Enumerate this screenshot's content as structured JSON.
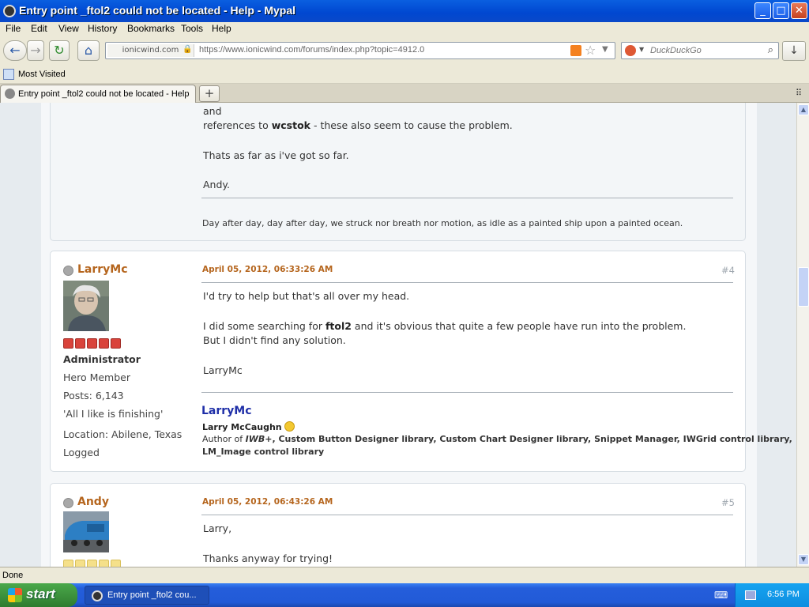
{
  "window": {
    "title": "Entry point _ftol2 could not be located - Help - Mypal",
    "min": "_",
    "max": "□",
    "close": "✕"
  },
  "menu": [
    "File",
    "Edit",
    "View",
    "History",
    "Bookmarks",
    "Tools",
    "Help"
  ],
  "nav": {
    "back": "←",
    "forward": "→",
    "reload": "↻",
    "home": "⌂",
    "site": "ionicwind.com",
    "url": "https://www.ionicwind.com/forums/index.php?topic=4912.0",
    "search_placeholder": "DuckDuckGo",
    "download": "↓"
  },
  "bookmarks": {
    "most_visited": "Most Visited"
  },
  "tabs": [
    {
      "label": "Entry point _ftol2 could not be located - Help"
    }
  ],
  "new_tab": "+",
  "tab_list": "⠿",
  "prev_post": {
    "lines": [
      "and",
      "references to ",
      "wcstok",
      " - these also seem to cause the problem.",
      "Thats as far as i've got so far.",
      "Andy."
    ],
    "signature": "Day after day, day after day, we struck nor breath nor motion, as idle as a painted ship upon a painted ocean."
  },
  "post4": {
    "poster": "LarryMc",
    "rank": "Administrator",
    "title": "Hero Member",
    "posts": "Posts: 6,143",
    "personal": "'All I like is finishing'",
    "location": "Location: Abilene, Texas",
    "logged": "Logged",
    "time": "April 05, 2012, 06:33:26 AM",
    "number": "#4",
    "body1": "I'd try to help but that's all over my head.",
    "body2a": "I did some searching for ",
    "body2b": "ftol2",
    "body2c": " and it's obvious that quite a few people have run into the problem.",
    "body3": "But I didn't find any solution.",
    "sign": "LarryMc",
    "sig_name": "LarryMc",
    "sig_full": "Larry McCaughn",
    "sig_author_pre": "Author of ",
    "sig_iwb": "IWB+",
    "sig_author_rest": ", Custom Button Designer library, Custom Chart Designer library, Snippet Manager, IWGrid control library,",
    "sig_line2": "LM_Image control library"
  },
  "post5": {
    "poster": "Andy",
    "time": "April 05, 2012, 06:43:26 AM",
    "number": "#5",
    "body1": "Larry,",
    "body2": "Thanks anyway for trying!"
  },
  "status": "Done",
  "taskbar": {
    "start": "start",
    "item": "Entry point _ftol2 cou...",
    "clock": "6:56 PM"
  }
}
